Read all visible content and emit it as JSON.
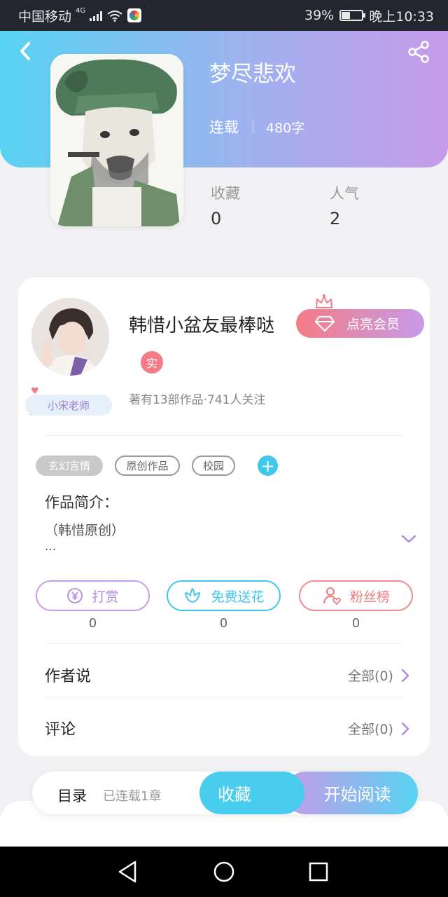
{
  "status_bar": {
    "carrier": "中国移动",
    "network": "4G",
    "battery": "39%",
    "time": "晚上10:33"
  },
  "book": {
    "title": "梦尽悲欢",
    "status": "连载",
    "word_count": "480字",
    "stats": [
      {
        "label": "收藏",
        "value": "0"
      },
      {
        "label": "人气",
        "value": "2"
      }
    ]
  },
  "author": {
    "name": "韩惜小盆友最棒哒",
    "vip_button": "点亮会员",
    "real_badge": "实",
    "meta": "著有13部作品·741人关注",
    "teacher_badge": "小宋老师"
  },
  "tags": [
    "玄幻言情",
    "原创作品",
    "校园"
  ],
  "intro": {
    "label": "作品简介：",
    "text": "（韩惜原创）",
    "more": "..."
  },
  "actions": [
    {
      "label": "打赏",
      "count": "0",
      "icon": "yuan-icon"
    },
    {
      "label": "免费送花",
      "count": "0",
      "icon": "flower-icon"
    },
    {
      "label": "粉丝榜",
      "count": "0",
      "icon": "fan-icon"
    }
  ],
  "sections": [
    {
      "label": "作者说",
      "right": "全部(0)"
    },
    {
      "label": "评论",
      "right": "全部(0)"
    }
  ],
  "bottom": {
    "toc": "目录",
    "toc_status": "已连载1章",
    "collect": "收藏",
    "read": "开始阅读"
  },
  "colors": {
    "header_gradient_start": "#58d3f2",
    "header_gradient_end": "#c69be9",
    "accent_cyan": "#3fc8ec",
    "accent_pink": "#f47c86",
    "accent_purple": "#c69be9"
  }
}
